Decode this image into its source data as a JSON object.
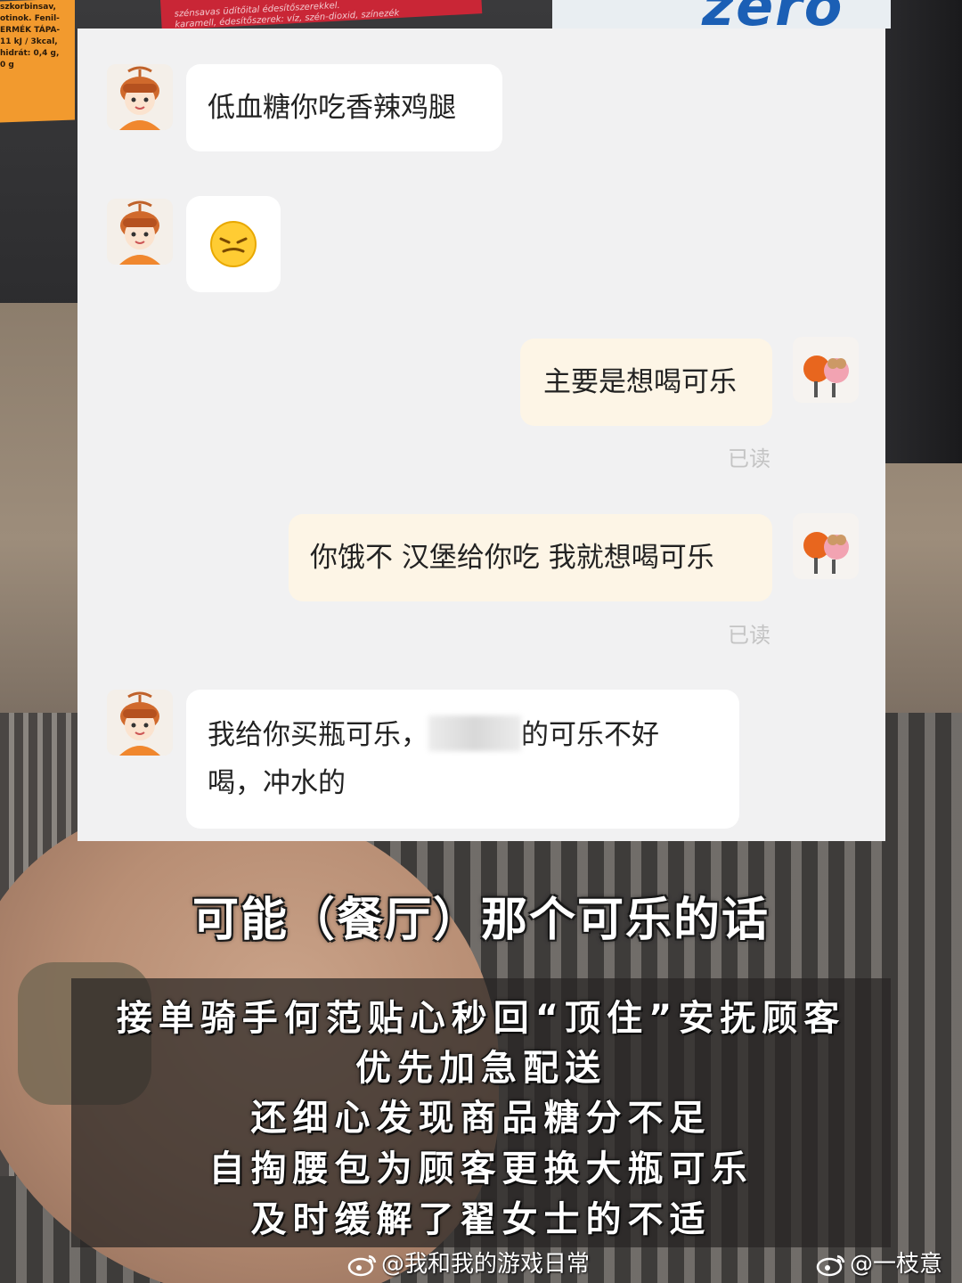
{
  "background": {
    "can_brand": "zero",
    "label_left_lines": [
      "szkorbinsav,",
      "otinok. Fenil-",
      "ERMÉK TÁPA-",
      "11 kJ / 3kcal,",
      "hidrát: 0,4 g,",
      "0 g"
    ],
    "label_top_lines": [
      "szénsavas üdítőital édesítőszerekkel.",
      "karamell, édesítőszerek: víz, szén-dioxid, színezék"
    ]
  },
  "chat": {
    "messages": [
      {
        "side": "in",
        "text": "低血糖你吃香辣鸡腿"
      },
      {
        "side": "in",
        "emoji": "😣"
      },
      {
        "side": "out",
        "text": "主要是想喝可乐",
        "status": "已读"
      },
      {
        "side": "out",
        "text": "你饿不 汉堡给你吃 我就想喝可乐",
        "status": "已读"
      },
      {
        "side": "in",
        "text_before": "我给你买瓶可乐，",
        "text_after": "的可乐不好",
        "text_line2": "喝，冲水的"
      }
    ]
  },
  "overlay": {
    "headline": "可能（餐厅）那个可乐的话",
    "caption_lines": [
      "接单骑手何范贴心秒回“顶住”安抚顾客",
      "优先加急配送",
      "还细心发现商品糖分不足",
      "自掏腰包为顾客更换大瓶可乐",
      "及时缓解了翟女士的不适"
    ]
  },
  "watermarks": {
    "left": "@我和我的游戏日常",
    "right": "@一枝意"
  }
}
